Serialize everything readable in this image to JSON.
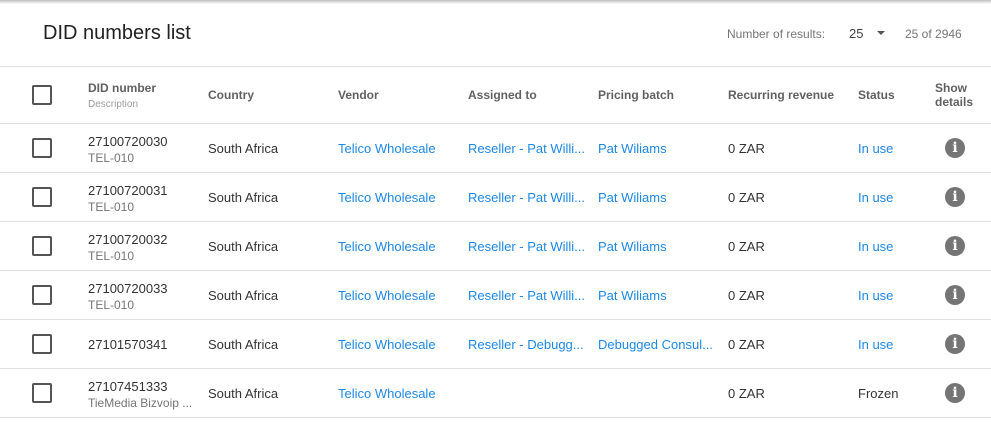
{
  "header": {
    "title": "DID numbers list",
    "results_label": "Number of results:",
    "page_size": "25",
    "range": "25 of 2946"
  },
  "columns": {
    "did_number": "DID number",
    "description": "Description",
    "country": "Country",
    "vendor": "Vendor",
    "assigned_to": "Assigned to",
    "pricing_batch": "Pricing batch",
    "recurring_revenue": "Recurring revenue",
    "status": "Status",
    "show_details_1": "Show",
    "show_details_2": "details"
  },
  "rows": [
    {
      "did": "27100720030",
      "desc": "TEL-010",
      "country": "South Africa",
      "vendor": "Telico Wholesale",
      "assigned": "Reseller - Pat Willi...",
      "pricing": "Pat Wiliams",
      "revenue": "0 ZAR",
      "status": "In use",
      "status_link": true
    },
    {
      "did": "27100720031",
      "desc": "TEL-010",
      "country": "South Africa",
      "vendor": "Telico Wholesale",
      "assigned": "Reseller - Pat Willi...",
      "pricing": "Pat Wiliams",
      "revenue": "0 ZAR",
      "status": "In use",
      "status_link": true
    },
    {
      "did": "27100720032",
      "desc": "TEL-010",
      "country": "South Africa",
      "vendor": "Telico Wholesale",
      "assigned": "Reseller - Pat Willi...",
      "pricing": "Pat Wiliams",
      "revenue": "0 ZAR",
      "status": "In use",
      "status_link": true
    },
    {
      "did": "27100720033",
      "desc": "TEL-010",
      "country": "South Africa",
      "vendor": "Telico Wholesale",
      "assigned": "Reseller - Pat Willi...",
      "pricing": "Pat Wiliams",
      "revenue": "0 ZAR",
      "status": "In use",
      "status_link": true
    },
    {
      "did": "27101570341",
      "desc": "",
      "country": "South Africa",
      "vendor": "Telico Wholesale",
      "assigned": "Reseller - Debugg...",
      "pricing": "Debugged Consul...",
      "revenue": "0 ZAR",
      "status": "In use",
      "status_link": true
    },
    {
      "did": "27107451333",
      "desc": "TieMedia Bizvoip ...",
      "country": "South Africa",
      "vendor": "Telico Wholesale",
      "assigned": "",
      "pricing": "",
      "revenue": "0 ZAR",
      "status": "Frozen",
      "status_link": false
    }
  ],
  "icons": {
    "info": "info-icon",
    "dropdown": "chevron-down-icon"
  },
  "colors": {
    "link": "#1e88e5",
    "icon": "#757575"
  }
}
